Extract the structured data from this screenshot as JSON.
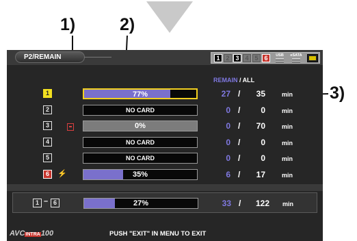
{
  "callouts": {
    "c1": "1)",
    "c2": "2)",
    "c3": "3)"
  },
  "title": "P2/REMAIN",
  "status": {
    "slots": [
      "1",
      "2",
      "3",
      "4",
      "5",
      "6"
    ],
    "usb_label": "USB",
    "esata_label": "eSATA",
    "monitor_icon": "monitor-icon"
  },
  "header": {
    "remain": "REMAIN",
    "all": " / ALL"
  },
  "slots": [
    {
      "num": "1",
      "status": "77%",
      "fill": 0.77,
      "remain": "27",
      "all": "35",
      "unit": "min",
      "active": true
    },
    {
      "num": "2",
      "status": "NO CARD",
      "fill": 0,
      "remain": "0",
      "all": "0",
      "unit": "min"
    },
    {
      "num": "3",
      "status": "0%",
      "fill": 0,
      "remain": "0",
      "all": "70",
      "unit": "min",
      "write_protect_icon": "write-protect-icon"
    },
    {
      "num": "4",
      "status": "NO CARD",
      "fill": 0,
      "remain": "0",
      "all": "0",
      "unit": "min"
    },
    {
      "num": "5",
      "status": "NO CARD",
      "fill": 0,
      "remain": "0",
      "all": "0",
      "unit": "min"
    },
    {
      "num": "6",
      "status": "35%",
      "fill": 0.35,
      "remain": "6",
      "all": "17",
      "unit": "min",
      "warning_icon": "lightning-warning-icon"
    }
  ],
  "total": {
    "from": "1",
    "dash": "–",
    "to": "6",
    "status": "27%",
    "fill": 0.27,
    "remain": "33",
    "all": "122",
    "unit": "min"
  },
  "footer": {
    "logo_avc": "AVC",
    "logo_intra": "INTRA",
    "logo_num": "100",
    "message": "PUSH \"EXIT\" IN MENU TO EXIT"
  },
  "colors": {
    "accent_yellow": "#f2e020",
    "remain_blue": "#7f78e0",
    "bar_fill": "#7a70cc",
    "slot_red": "#c8342c"
  }
}
